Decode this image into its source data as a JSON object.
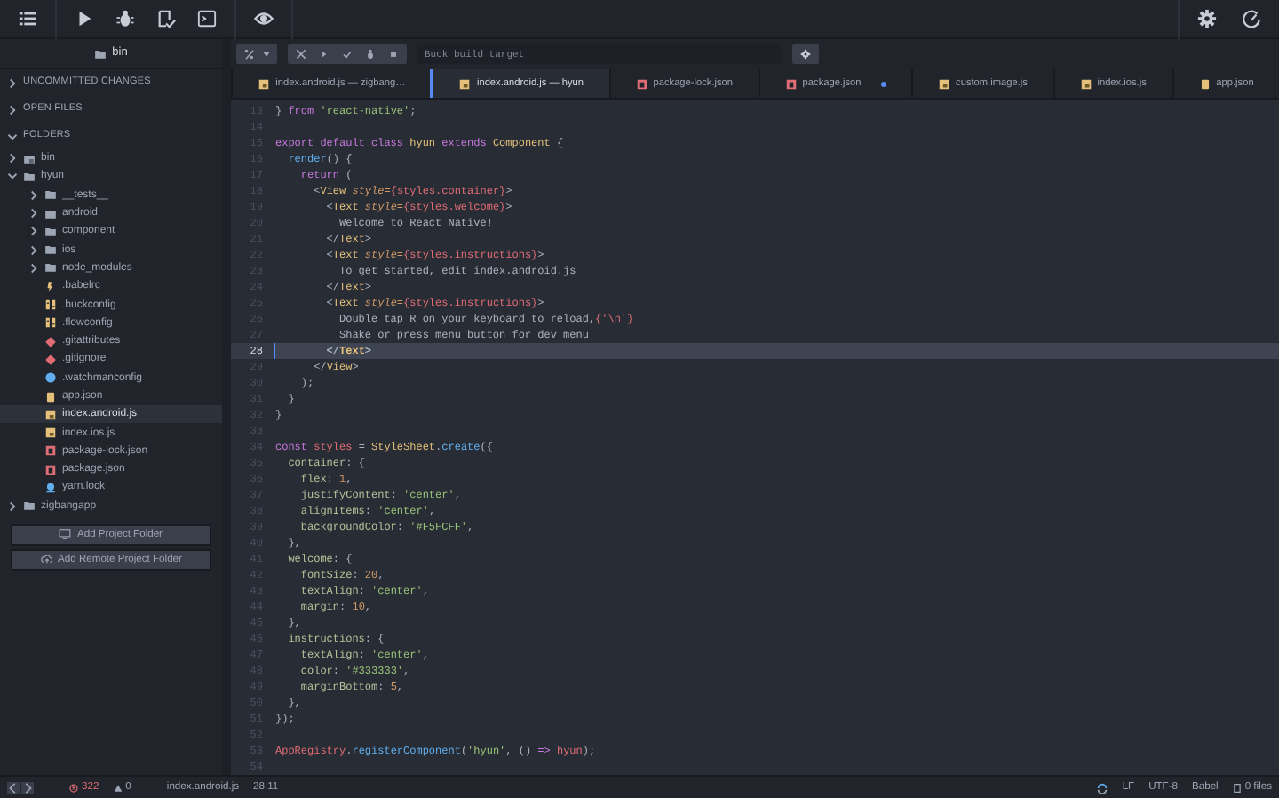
{
  "sidebar": {
    "header": "bin",
    "sections": [
      {
        "label": "UNCOMMITTED CHANGES",
        "expanded": false
      },
      {
        "label": "OPEN FILES",
        "expanded": false
      },
      {
        "label": "FOLDERS",
        "expanded": true
      }
    ],
    "tree": [
      {
        "label": "bin",
        "kind": "repo",
        "expanded": false,
        "selected": false
      },
      {
        "label": "hyun",
        "kind": "folder",
        "expanded": true,
        "selected": false,
        "children": [
          {
            "label": "__tests__",
            "kind": "folder",
            "expanded": false,
            "selected": false
          },
          {
            "label": "android",
            "kind": "folder",
            "expanded": false,
            "selected": false
          },
          {
            "label": "component",
            "kind": "folder",
            "expanded": false,
            "selected": false
          },
          {
            "label": "ios",
            "kind": "folder",
            "expanded": false,
            "selected": false
          },
          {
            "label": "node_modules",
            "kind": "folder",
            "expanded": false,
            "selected": false
          },
          {
            "label": ".babelrc",
            "kind": "babel",
            "selected": false
          },
          {
            "label": ".buckconfig",
            "kind": "config",
            "selected": false
          },
          {
            "label": ".flowconfig",
            "kind": "config",
            "selected": false
          },
          {
            "label": ".gitattributes",
            "kind": "git",
            "selected": false
          },
          {
            "label": ".gitignore",
            "kind": "git",
            "selected": false
          },
          {
            "label": ".watchmanconfig",
            "kind": "watchman",
            "selected": false
          },
          {
            "label": "app.json",
            "kind": "json",
            "selected": false
          },
          {
            "label": "index.android.js",
            "kind": "js",
            "selected": true
          },
          {
            "label": "index.ios.js",
            "kind": "js",
            "selected": false
          },
          {
            "label": "package-lock.json",
            "kind": "npm",
            "selected": false
          },
          {
            "label": "package.json",
            "kind": "npm",
            "selected": false
          },
          {
            "label": "yarn.lock",
            "kind": "yarn",
            "selected": false
          }
        ]
      },
      {
        "label": "zigbangapp",
        "kind": "folder",
        "expanded": false,
        "selected": false
      }
    ],
    "buttons": [
      {
        "label": "Add Project Folder"
      },
      {
        "label": "Add Remote Project Folder"
      }
    ]
  },
  "buck": {
    "placeholder": "Buck build target"
  },
  "tabs": [
    {
      "label": "index.android.js — zigbang…",
      "kind": "js",
      "selected": false,
      "modified": false
    },
    {
      "label": "index.android.js — hyun",
      "kind": "js",
      "selected": true,
      "modified": false
    },
    {
      "label": "package-lock.json",
      "kind": "npm",
      "selected": false,
      "modified": false
    },
    {
      "label": "package.json",
      "kind": "npm",
      "selected": false,
      "modified": true
    },
    {
      "label": "custom.image.js",
      "kind": "js",
      "selected": false,
      "modified": false
    },
    {
      "label": "index.ios.js",
      "kind": "js",
      "selected": false,
      "modified": false
    },
    {
      "label": "app.json",
      "kind": "json",
      "selected": false,
      "modified": false
    }
  ],
  "code": {
    "lines": [
      {
        "number": "13",
        "current": false,
        "tokens": [
          {
            "text": "} ",
            "kind": "plain"
          },
          {
            "text": "from ",
            "kind": "kw"
          },
          {
            "text": "'react-native'",
            "kind": "str"
          },
          {
            "text": ";",
            "kind": "plain"
          }
        ]
      },
      {
        "number": "14",
        "current": false
      },
      {
        "number": "15",
        "current": false,
        "tokens": [
          {
            "text": "export default class ",
            "kind": "kw"
          },
          {
            "text": "hyun",
            "kind": "cls"
          },
          {
            "text": " extends ",
            "kind": "kw"
          },
          {
            "text": "Component",
            "kind": "cls"
          },
          {
            "text": " {",
            "kind": "plain"
          }
        ]
      },
      {
        "number": "16",
        "current": false,
        "tokens": [
          {
            "text": "  render",
            "kind": "fn"
          },
          {
            "text": "() {",
            "kind": "plain"
          }
        ]
      },
      {
        "number": "17",
        "current": false,
        "tokens": [
          {
            "text": "    return",
            "kind": "kw"
          },
          {
            "text": " (",
            "kind": "plain"
          }
        ]
      },
      {
        "number": "18",
        "current": false,
        "tokens": [
          {
            "text": "      <",
            "kind": "plain"
          },
          {
            "text": "View",
            "kind": "tag"
          },
          {
            "text": " style=",
            "kind": "attr"
          },
          {
            "text": "{styles.container}",
            "kind": "expr"
          },
          {
            "text": ">",
            "kind": "plain"
          }
        ]
      },
      {
        "number": "19",
        "current": false,
        "tokens": [
          {
            "text": "        <",
            "kind": "plain"
          },
          {
            "text": "Text",
            "kind": "tag"
          },
          {
            "text": " style=",
            "kind": "attr"
          },
          {
            "text": "{styles.welcome}",
            "kind": "expr"
          },
          {
            "text": ">",
            "kind": "plain"
          }
        ]
      },
      {
        "number": "20",
        "current": false,
        "tokens": [
          {
            "text": "          Welcome to React Native!",
            "kind": "plain"
          }
        ]
      },
      {
        "number": "21",
        "current": false,
        "tokens": [
          {
            "text": "        </",
            "kind": "plain"
          },
          {
            "text": "Text",
            "kind": "tag"
          },
          {
            "text": ">",
            "kind": "plain"
          }
        ]
      },
      {
        "number": "22",
        "current": false,
        "tokens": [
          {
            "text": "        <",
            "kind": "plain"
          },
          {
            "text": "Text",
            "kind": "tag"
          },
          {
            "text": " style=",
            "kind": "attr"
          },
          {
            "text": "{styles.instructions}",
            "kind": "expr"
          },
          {
            "text": ">",
            "kind": "plain"
          }
        ]
      },
      {
        "number": "23",
        "current": false,
        "tokens": [
          {
            "text": "          To get started, edit index.android.js",
            "kind": "plain"
          }
        ]
      },
      {
        "number": "24",
        "current": false,
        "tokens": [
          {
            "text": "        </",
            "kind": "plain"
          },
          {
            "text": "Text",
            "kind": "tag"
          },
          {
            "text": ">",
            "kind": "plain"
          }
        ]
      },
      {
        "number": "25",
        "current": false,
        "tokens": [
          {
            "text": "        <",
            "kind": "plain"
          },
          {
            "text": "Text",
            "kind": "tag"
          },
          {
            "text": " style=",
            "kind": "attr"
          },
          {
            "text": "{styles.instructions}",
            "kind": "expr"
          },
          {
            "text": ">",
            "kind": "plain"
          }
        ]
      },
      {
        "number": "26",
        "current": false,
        "tokens": [
          {
            "text": "          Double tap R on your keyboard to reload,",
            "kind": "plain"
          },
          {
            "text": "{'\\n'}",
            "kind": "expr"
          }
        ]
      },
      {
        "number": "27",
        "current": false,
        "tokens": [
          {
            "text": "          Shake or press menu button for dev menu",
            "kind": "plain"
          }
        ]
      },
      {
        "number": "28",
        "current": true,
        "tokens": [
          {
            "text": "        </",
            "kind": "plain"
          },
          {
            "text": "Text",
            "kind": "tag"
          },
          {
            "text": ">",
            "kind": "plain"
          }
        ]
      },
      {
        "number": "29",
        "current": false,
        "tokens": [
          {
            "text": "      </",
            "kind": "plain"
          },
          {
            "text": "View",
            "kind": "tag"
          },
          {
            "text": ">",
            "kind": "plain"
          }
        ]
      },
      {
        "number": "30",
        "current": false,
        "tokens": [
          {
            "text": "    );",
            "kind": "plain"
          }
        ]
      },
      {
        "number": "31",
        "current": false,
        "tokens": [
          {
            "text": "  }",
            "kind": "plain"
          }
        ]
      },
      {
        "number": "32",
        "current": false,
        "tokens": [
          {
            "text": "}",
            "kind": "plain"
          }
        ]
      },
      {
        "number": "33",
        "current": false
      },
      {
        "number": "34",
        "current": false,
        "tokens": [
          {
            "text": "const ",
            "kind": "kw"
          },
          {
            "text": "styles",
            "kind": "var"
          },
          {
            "text": " = ",
            "kind": "plain"
          },
          {
            "text": "StyleSheet",
            "kind": "cls"
          },
          {
            "text": ".",
            "kind": "plain"
          },
          {
            "text": "create",
            "kind": "fn"
          },
          {
            "text": "({",
            "kind": "plain"
          }
        ]
      },
      {
        "number": "35",
        "current": false,
        "tokens": [
          {
            "text": "  container",
            "kind": "key"
          },
          {
            "text": ": {",
            "kind": "plain"
          }
        ]
      },
      {
        "number": "36",
        "current": false,
        "tokens": [
          {
            "text": "    flex",
            "kind": "key"
          },
          {
            "text": ": ",
            "kind": "plain"
          },
          {
            "text": "1",
            "kind": "num"
          },
          {
            "text": ",",
            "kind": "plain"
          }
        ]
      },
      {
        "number": "37",
        "current": false,
        "tokens": [
          {
            "text": "    justifyContent",
            "kind": "key"
          },
          {
            "text": ": ",
            "kind": "plain"
          },
          {
            "text": "'center'",
            "kind": "str"
          },
          {
            "text": ",",
            "kind": "plain"
          }
        ]
      },
      {
        "number": "38",
        "current": false,
        "tokens": [
          {
            "text": "    alignItems",
            "kind": "key"
          },
          {
            "text": ": ",
            "kind": "plain"
          },
          {
            "text": "'center'",
            "kind": "str"
          },
          {
            "text": ",",
            "kind": "plain"
          }
        ]
      },
      {
        "number": "39",
        "current": false,
        "tokens": [
          {
            "text": "    backgroundColor",
            "kind": "key"
          },
          {
            "text": ": ",
            "kind": "plain"
          },
          {
            "text": "'#F5FCFF'",
            "kind": "str"
          },
          {
            "text": ",",
            "kind": "plain"
          }
        ]
      },
      {
        "number": "40",
        "current": false,
        "tokens": [
          {
            "text": "  },",
            "kind": "plain"
          }
        ]
      },
      {
        "number": "41",
        "current": false,
        "tokens": [
          {
            "text": "  welcome",
            "kind": "key"
          },
          {
            "text": ": {",
            "kind": "plain"
          }
        ]
      },
      {
        "number": "42",
        "current": false,
        "tokens": [
          {
            "text": "    fontSize",
            "kind": "key"
          },
          {
            "text": ": ",
            "kind": "plain"
          },
          {
            "text": "20",
            "kind": "num"
          },
          {
            "text": ",",
            "kind": "plain"
          }
        ]
      },
      {
        "number": "43",
        "current": false,
        "tokens": [
          {
            "text": "    textAlign",
            "kind": "key"
          },
          {
            "text": ": ",
            "kind": "plain"
          },
          {
            "text": "'center'",
            "kind": "str"
          },
          {
            "text": ",",
            "kind": "plain"
          }
        ]
      },
      {
        "number": "44",
        "current": false,
        "tokens": [
          {
            "text": "    margin",
            "kind": "key"
          },
          {
            "text": ": ",
            "kind": "plain"
          },
          {
            "text": "10",
            "kind": "num"
          },
          {
            "text": ",",
            "kind": "plain"
          }
        ]
      },
      {
        "number": "45",
        "current": false,
        "tokens": [
          {
            "text": "  },",
            "kind": "plain"
          }
        ]
      },
      {
        "number": "46",
        "current": false,
        "tokens": [
          {
            "text": "  instructions",
            "kind": "key"
          },
          {
            "text": ": {",
            "kind": "plain"
          }
        ]
      },
      {
        "number": "47",
        "current": false,
        "tokens": [
          {
            "text": "    textAlign",
            "kind": "key"
          },
          {
            "text": ": ",
            "kind": "plain"
          },
          {
            "text": "'center'",
            "kind": "str"
          },
          {
            "text": ",",
            "kind": "plain"
          }
        ]
      },
      {
        "number": "48",
        "current": false,
        "tokens": [
          {
            "text": "    color",
            "kind": "key"
          },
          {
            "text": ": ",
            "kind": "plain"
          },
          {
            "text": "'#333333'",
            "kind": "str"
          },
          {
            "text": ",",
            "kind": "plain"
          }
        ]
      },
      {
        "number": "49",
        "current": false,
        "tokens": [
          {
            "text": "    marginBottom",
            "kind": "key"
          },
          {
            "text": ": ",
            "kind": "plain"
          },
          {
            "text": "5",
            "kind": "num"
          },
          {
            "text": ",",
            "kind": "plain"
          }
        ]
      },
      {
        "number": "50",
        "current": false,
        "tokens": [
          {
            "text": "  },",
            "kind": "plain"
          }
        ]
      },
      {
        "number": "51",
        "current": false,
        "tokens": [
          {
            "text": "});",
            "kind": "plain"
          }
        ]
      },
      {
        "number": "52",
        "current": false
      },
      {
        "number": "53",
        "current": false,
        "tokens": [
          {
            "text": "AppRegistry",
            "kind": "var"
          },
          {
            "text": ".",
            "kind": "plain"
          },
          {
            "text": "registerComponent",
            "kind": "fn"
          },
          {
            "text": "(",
            "kind": "plain"
          },
          {
            "text": "'hyun'",
            "kind": "str"
          },
          {
            "text": ", () ",
            "kind": "plain"
          },
          {
            "text": "=>",
            "kind": "kw"
          },
          {
            "text": " hyun",
            "kind": "var"
          },
          {
            "text": ");",
            "kind": "plain"
          }
        ]
      },
      {
        "number": "54",
        "current": false
      }
    ]
  },
  "status_bar": {
    "errors": "322",
    "warnings": "0",
    "file": "index.android.js",
    "cursor": "28:11",
    "line_ending": "LF",
    "encoding": "UTF-8",
    "grammar": "Babel",
    "git": "0 files"
  }
}
